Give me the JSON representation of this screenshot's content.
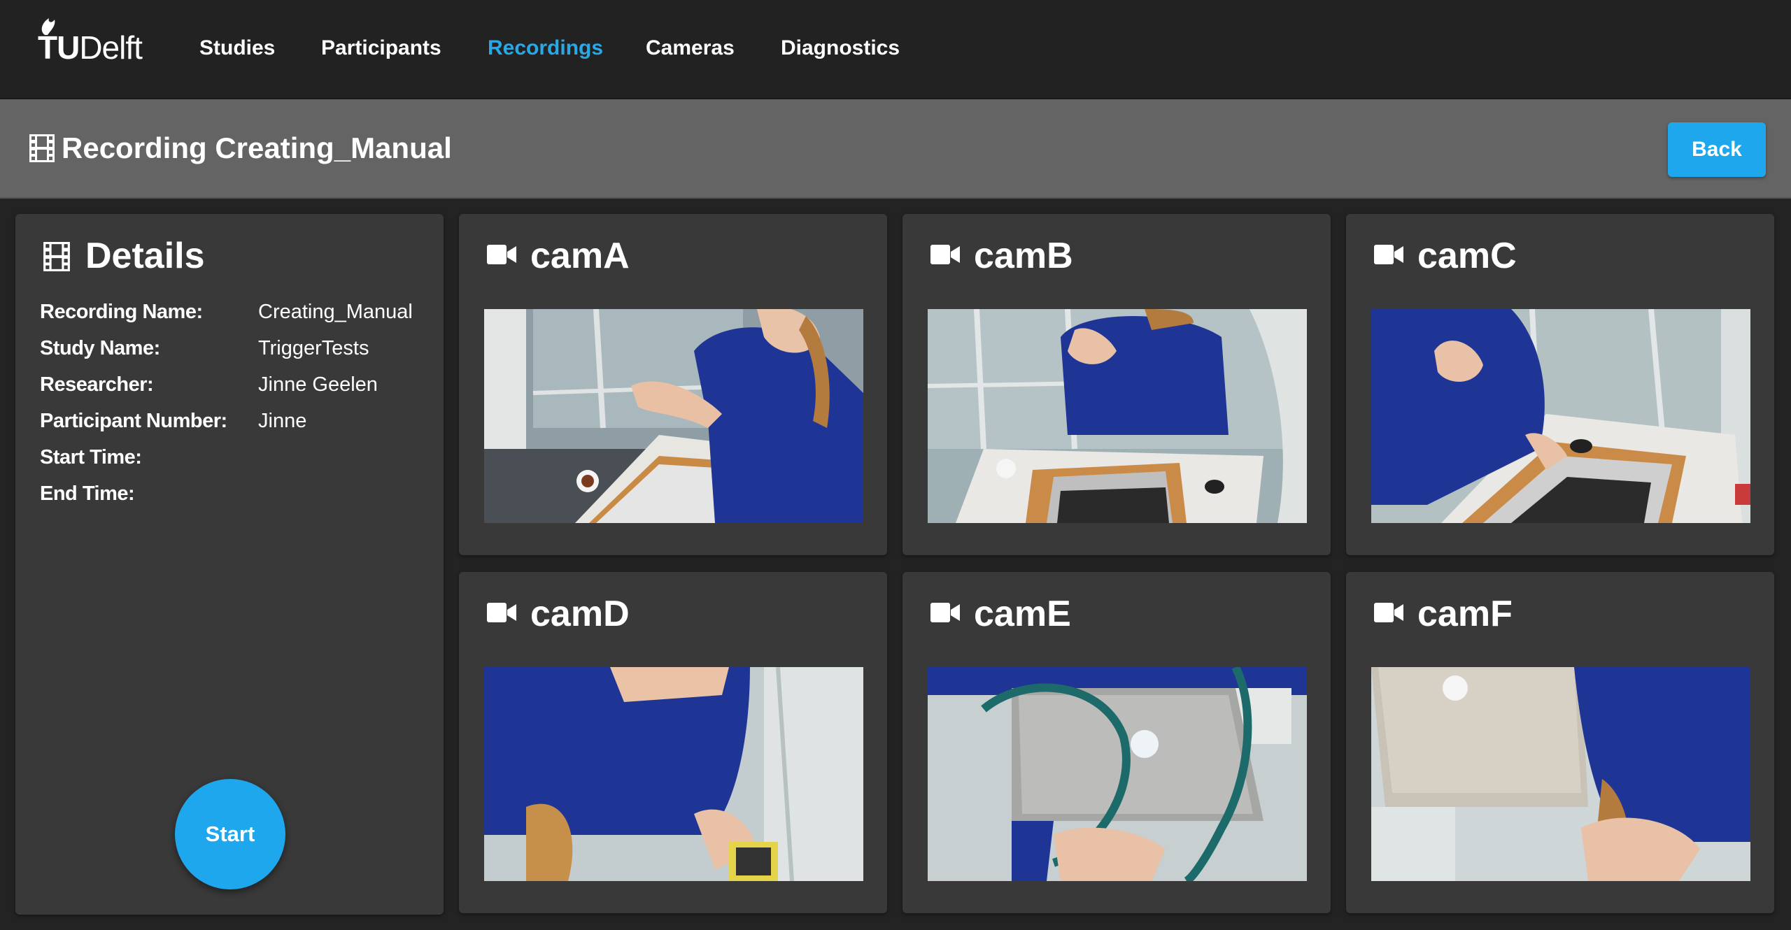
{
  "nav": {
    "logo_tu": "TU",
    "logo_delft": "Delft",
    "items": [
      {
        "label": "Studies",
        "active": false
      },
      {
        "label": "Participants",
        "active": false
      },
      {
        "label": "Recordings",
        "active": true
      },
      {
        "label": "Cameras",
        "active": false
      },
      {
        "label": "Diagnostics",
        "active": false
      }
    ]
  },
  "header": {
    "title": "Recording Creating_Manual",
    "icon": "film-icon",
    "back_label": "Back"
  },
  "details": {
    "title": "Details",
    "icon": "film-icon",
    "rows": [
      {
        "label": "Recording Name:",
        "value": "Creating_Manual"
      },
      {
        "label": "Study Name:",
        "value": "TriggerTests"
      },
      {
        "label": "Researcher:",
        "value": "Jinne Geelen"
      },
      {
        "label": "Participant Number:",
        "value": "Jinne"
      },
      {
        "label": "Start Time:",
        "value": ""
      },
      {
        "label": "End Time:",
        "value": ""
      }
    ],
    "start_label": "Start"
  },
  "cameras": [
    {
      "name": "camA",
      "icon": "video-camera-icon"
    },
    {
      "name": "camB",
      "icon": "video-camera-icon"
    },
    {
      "name": "camC",
      "icon": "video-camera-icon"
    },
    {
      "name": "camD",
      "icon": "video-camera-icon"
    },
    {
      "name": "camE",
      "icon": "video-camera-icon"
    },
    {
      "name": "camF",
      "icon": "video-camera-icon"
    }
  ],
  "colors": {
    "accent": "#1ea7ec",
    "active_nav": "#2aa8e6",
    "navbar_bg": "#222222",
    "titlebar_bg": "#646464",
    "panel_bg": "#393939",
    "page_bg": "#232323"
  }
}
